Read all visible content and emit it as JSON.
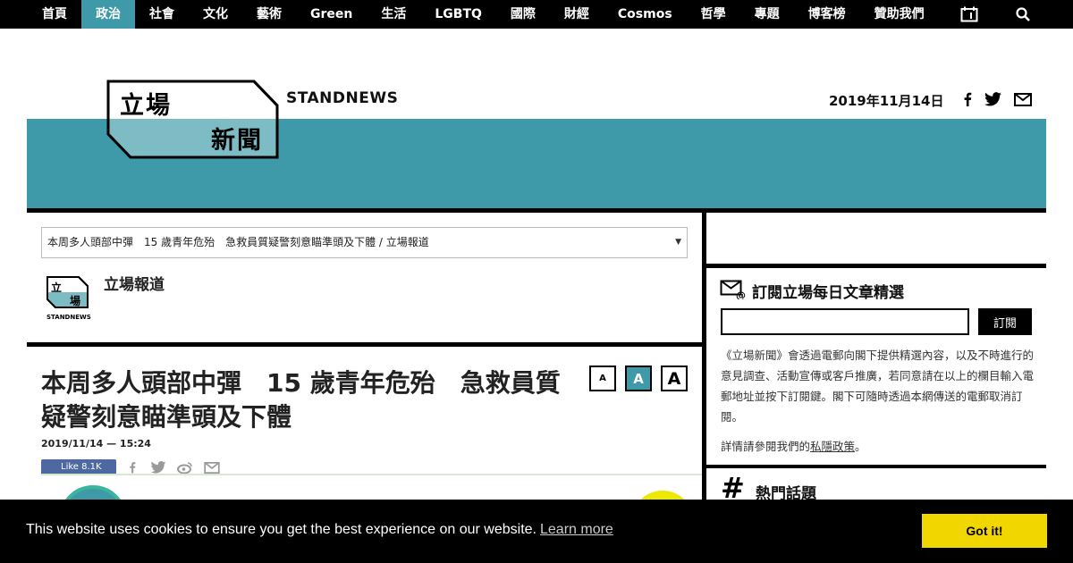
{
  "nav": {
    "items": [
      {
        "label": "首頁",
        "active": false
      },
      {
        "label": "政治",
        "active": true
      },
      {
        "label": "社會",
        "active": false
      },
      {
        "label": "文化",
        "active": false
      },
      {
        "label": "藝術",
        "active": false
      },
      {
        "label": "Green",
        "active": false
      },
      {
        "label": "生活",
        "active": false
      },
      {
        "label": "LGBTQ",
        "active": false
      },
      {
        "label": "國際",
        "active": false
      },
      {
        "label": "財經",
        "active": false
      },
      {
        "label": "Cosmos",
        "active": false
      },
      {
        "label": "哲學",
        "active": false
      },
      {
        "label": "專題",
        "active": false
      },
      {
        "label": "博客榜",
        "active": false
      },
      {
        "label": "贊助我們",
        "active": false
      }
    ],
    "icons": [
      "calendar-icon",
      "search-icon"
    ]
  },
  "header": {
    "logo_line1": "立場",
    "logo_line2": "新聞",
    "brand": "STANDNEWS",
    "date": "2019年11月14日",
    "social_icons": [
      "facebook-icon",
      "twitter-icon",
      "mail-icon"
    ]
  },
  "article": {
    "select_value": "本周多人頭部中彈　15 歲青年危殆　急救員質疑警刻意瞄準頭及下體 / 立場報道",
    "author_logo_line1": "立",
    "author_logo_line2": "場",
    "author_logo_sub": "STANDNEWS",
    "author": "立場報道",
    "title": "本周多人頭部中彈　15 歲青年危殆　急救員質疑警刻意瞄準頭及下體",
    "date": "2019/11/14 — 15:24",
    "font_sizes": [
      "A",
      "A",
      "A"
    ],
    "like_label": "Like 8.1K",
    "share_icons": [
      "facebook-icon",
      "twitter-icon",
      "weibo-icon",
      "mail-icon"
    ]
  },
  "sidebar": {
    "subscribe_title": "訂閱立場每日文章精選",
    "subscribe_input_value": "",
    "subscribe_button": "訂閱",
    "subscribe_desc": "《立場新聞》會透過電郵向閣下提供精選內容，以及不時進行的意見調查、活動宣傳或客戶推廣，若同意請在以上的欄目輸入電郵地址並按下訂閱鍵。閣下可隨時透過本網傳送的電郵取消訂閱。",
    "privacy_prefix": "詳情請參閱我們的",
    "privacy_link": "私隱政策",
    "privacy_suffix": "。",
    "hot_topics_title": "熱門話題"
  },
  "cookie": {
    "message": "This website uses cookies to ensure you get the best experience on our website.",
    "learn_more": "Learn more",
    "accept": "Got it!"
  },
  "colors": {
    "accent": "#3e99a8",
    "cookie_button": "#f1d600"
  }
}
